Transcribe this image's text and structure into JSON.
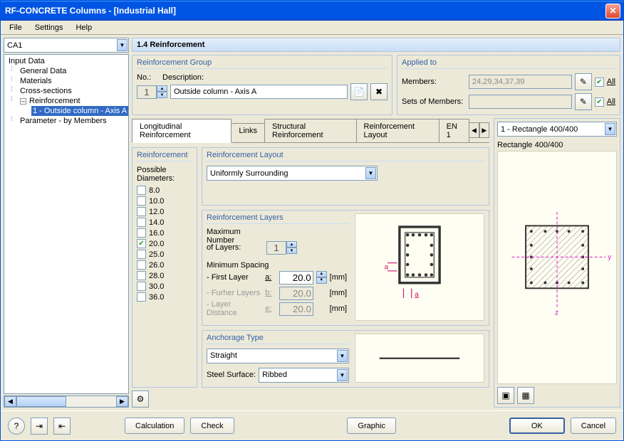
{
  "window": {
    "title": "RF-CONCRETE Columns - [Industrial Hall]"
  },
  "menu": {
    "file": "File",
    "settings": "Settings",
    "help": "Help"
  },
  "left": {
    "case": "CA1",
    "tree": {
      "root": "Input Data",
      "general": "General Data",
      "materials": "Materials",
      "cross": "Cross-sections",
      "reinforcement": "Reinforcement",
      "reinf_child": "1 - Outside column - Axis A",
      "parameter": "Parameter - by Members"
    }
  },
  "section": "1.4 Reinforcement",
  "rgroup": {
    "title": "Reinforcement Group",
    "no_label": "No.:",
    "no_val": "1",
    "desc_label": "Description:",
    "desc_val": "Outside column - Axis A"
  },
  "applied": {
    "title": "Applied to",
    "members": "Members:",
    "members_val": "24,29,34,37,39",
    "sets": "Sets of Members:",
    "all": "All"
  },
  "tabs": {
    "t1": "Longitudinal Reinforcement",
    "t2": "Links",
    "t3": "Structural Reinforcement",
    "t4": "Reinforcement Layout",
    "t5": "EN 1"
  },
  "reinf_col": {
    "title": "Reinforcement",
    "possible": "Possible",
    "diameters": "Diameters:",
    "items": [
      "8.0",
      "10.0",
      "12.0",
      "14.0",
      "16.0",
      "20.0",
      "25.0",
      "26.0",
      "28.0",
      "30.0",
      "36.0"
    ],
    "checked": [
      false,
      false,
      false,
      false,
      false,
      true,
      false,
      false,
      false,
      false,
      false
    ]
  },
  "layout": {
    "title": "Reinforcement Layout",
    "value": "Uniformly Surrounding"
  },
  "layers": {
    "title": "Reinforcement Layers",
    "max_label1": "Maximum Number",
    "max_label2": "of Layers:",
    "max_val": "1",
    "min_spacing": "Minimum Spacing",
    "first": "- First Layer",
    "first_var": "a:",
    "first_val": "20.0",
    "further": "- Furher Layers",
    "further_var": "b:",
    "further_val": "20.0",
    "dist": "- Layer Distance",
    "dist_var": "e:",
    "dist_val": "20.0",
    "mm": "[mm]"
  },
  "anchorage": {
    "title": "Anchorage Type",
    "type": "Straight",
    "surface_label": "Steel Surface:",
    "surface": "Ribbed"
  },
  "preview": {
    "select": "1 - Rectangle 400/400",
    "label": "Rectangle 400/400"
  },
  "buttons": {
    "calc": "Calculation",
    "check": "Check",
    "graphic": "Graphic",
    "ok": "OK",
    "cancel": "Cancel"
  }
}
